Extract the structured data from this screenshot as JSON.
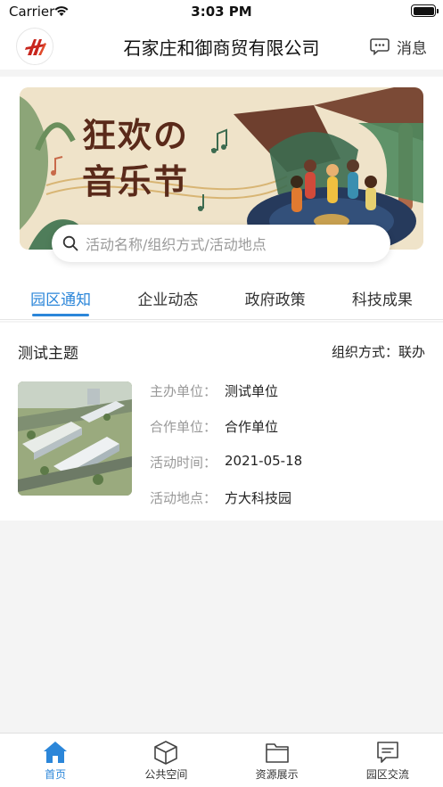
{
  "status_bar": {
    "carrier": "Carrier",
    "time": "3:03 PM"
  },
  "header": {
    "title": "石家庄和御商贸有限公司",
    "message_label": "消息"
  },
  "banner": {
    "line1": "狂欢の",
    "line2": "音乐节"
  },
  "search": {
    "placeholder": "活动名称/组织方式/活动地点"
  },
  "tabs": [
    {
      "label": "园区通知",
      "active": true
    },
    {
      "label": "企业动态",
      "active": false
    },
    {
      "label": "政府政策",
      "active": false
    },
    {
      "label": "科技成果",
      "active": false
    }
  ],
  "activity": {
    "subject": "测试主题",
    "org_mode": "组织方式：联办",
    "details": [
      {
        "key": "主办单位：",
        "value": "测试单位"
      },
      {
        "key": "合作单位：",
        "value": "合作单位"
      },
      {
        "key": "活动时间：",
        "value": "2021-05-18"
      },
      {
        "key": "活动地点：",
        "value": "方大科技园"
      }
    ]
  },
  "bottom_tabs": [
    {
      "label": "首页",
      "icon": "home-icon",
      "active": true
    },
    {
      "label": "公共空间",
      "icon": "cube-icon",
      "active": false
    },
    {
      "label": "资源展示",
      "icon": "folder-icon",
      "active": false
    },
    {
      "label": "园区交流",
      "icon": "chat-icon",
      "active": false
    }
  ],
  "colors": {
    "accent": "#2b86d9",
    "background": "#f4f4f4"
  }
}
